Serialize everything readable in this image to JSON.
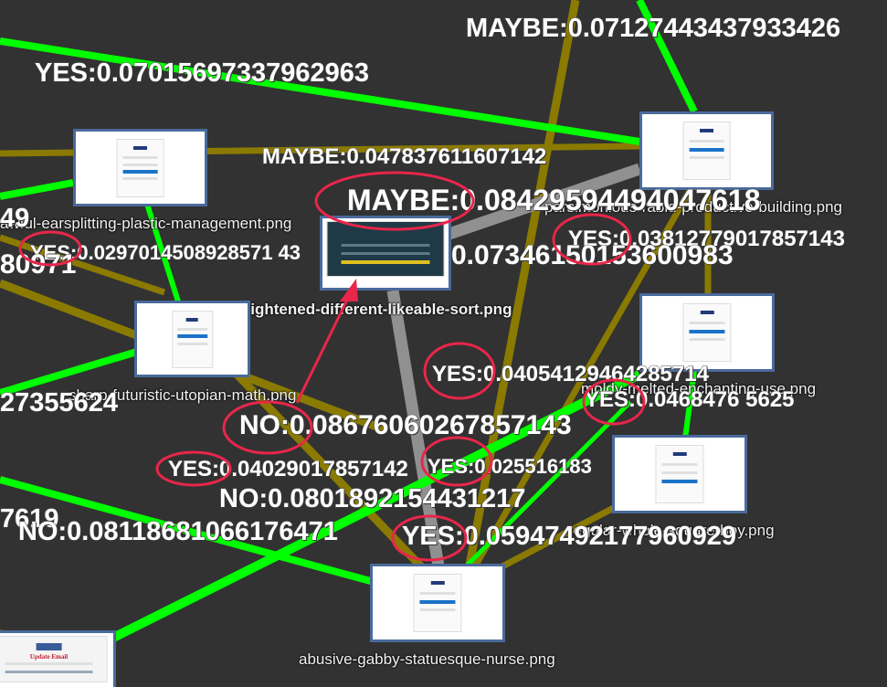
{
  "nodes": [
    {
      "file": "awful-earsplitting-plastic-management.png"
    },
    {
      "file": "frightened-different-likeable-sort.png"
    },
    {
      "file": "parsimonious-rabid-productive-building.png"
    },
    {
      "file": "sharp-futuristic-utopian-math.png"
    },
    {
      "file": "moldy-melted-enchanting-use.png"
    },
    {
      "file": "regular-whole-square-boy.png"
    },
    {
      "file": "abusive-gabby-statuesque-nurse.png"
    },
    {
      "file": "",
      "thumb_title": "Update Email"
    }
  ],
  "edge_labels": [
    "MAYBE:0.07127443437933426",
    "YES:0.07015697337962963",
    "MAYBE:0.047837611607142",
    "MAYBE:0.08429594494047618",
    "49",
    "YES:0.0297014508928571 43",
    "80971",
    "YES:0.03812779017857143",
    "0.07346150153600983",
    "YES:0.04054129464285714",
    "YES:0.0468476 5625",
    "27355624",
    "NO:0.08676060267857143",
    "YES:0.04029017857142",
    "YES:0.025516183",
    "NO:0.0801892154431217",
    "7619",
    "NO:0.08118681066176471",
    "YES:0.05947492177960929"
  ],
  "colors": {
    "background": "#323232",
    "edge_yes": "#00ff00",
    "edge_maybe": "#8a7a00",
    "edge_no": "#909090",
    "annotation": "#e8264a",
    "node_border": "#4a6a9c"
  },
  "icons": [
    "paypal-logo-icon"
  ]
}
